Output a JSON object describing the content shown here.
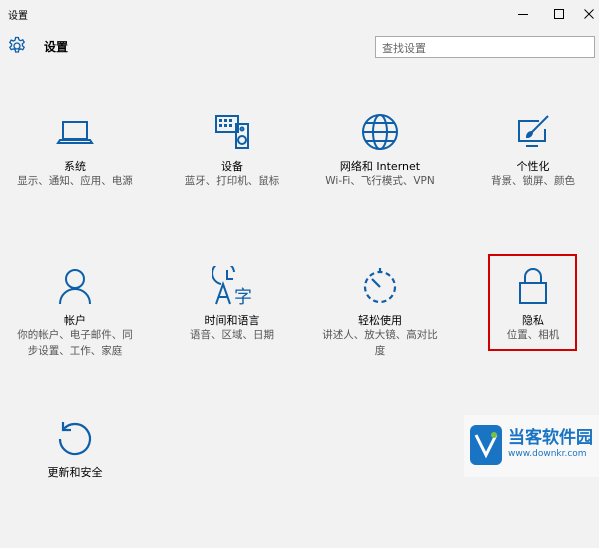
{
  "window": {
    "title": "设置",
    "controls": [
      "minimize",
      "maximize",
      "close"
    ]
  },
  "header": {
    "icon": "gear-icon",
    "title": "设置",
    "search_placeholder": "查找设置"
  },
  "tiles": [
    {
      "id": "system",
      "icon": "laptop-icon",
      "name": "系统",
      "desc": "显示、通知、应用、电源"
    },
    {
      "id": "devices",
      "icon": "keyboard-speaker-icon",
      "name": "设备",
      "desc": "蓝牙、打印机、鼠标"
    },
    {
      "id": "network",
      "icon": "globe-icon",
      "name": "网络和 Internet",
      "desc": "Wi-Fi、飞行模式、VPN"
    },
    {
      "id": "personalization",
      "icon": "paintbrush-screen-icon",
      "name": "个性化",
      "desc": "背景、锁屏、颜色"
    },
    {
      "id": "accounts",
      "icon": "person-icon",
      "name": "帐户",
      "desc": "你的帐户、电子邮件、同步设置、工作、家庭"
    },
    {
      "id": "time-language",
      "icon": "time-language-icon",
      "name": "时间和语言",
      "desc": "语音、区域、日期"
    },
    {
      "id": "ease-of-access",
      "icon": "timer-dashed-icon",
      "name": "轻松使用",
      "desc": "讲述人、放大镜、高对比度"
    },
    {
      "id": "privacy",
      "icon": "lock-icon",
      "name": "隐私",
      "desc": "位置、相机",
      "highlighted": true
    },
    {
      "id": "update-security",
      "icon": "refresh-icon",
      "name": "更新和安全",
      "desc": ""
    }
  ],
  "watermark": {
    "text": "当客软件园",
    "url": "www.downkr.com"
  },
  "colors": {
    "background": "#f2f2f2",
    "icon_accent": "#0e5fa8",
    "highlight_border": "#d00000",
    "watermark_blue": "#1a74c4"
  }
}
